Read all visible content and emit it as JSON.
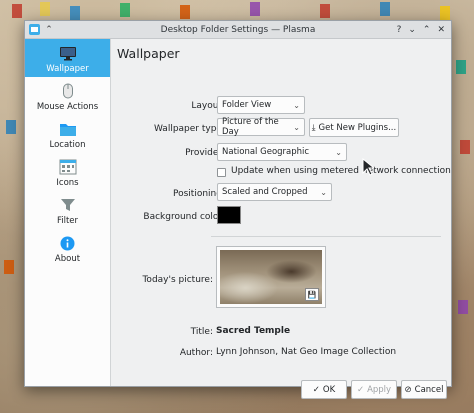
{
  "window": {
    "title": "Desktop Folder Settings — Plasma"
  },
  "sidebar": {
    "items": [
      {
        "label": "Wallpaper",
        "icon": "monitor-icon",
        "active": true
      },
      {
        "label": "Mouse Actions",
        "icon": "mouse-icon",
        "active": false
      },
      {
        "label": "Location",
        "icon": "folder-icon",
        "active": false
      },
      {
        "label": "Icons",
        "icon": "icons-grid-icon",
        "active": false
      },
      {
        "label": "Filter",
        "icon": "filter-icon",
        "active": false
      },
      {
        "label": "About",
        "icon": "info-icon",
        "active": false
      }
    ]
  },
  "main": {
    "heading": "Wallpaper",
    "layout": {
      "label": "Layout:",
      "value": "Folder View"
    },
    "wallpaper_type": {
      "label": "Wallpaper type:",
      "value": "Picture of the Day"
    },
    "get_plugins": {
      "label": "Get New Plugins..."
    },
    "provider": {
      "label": "Provider:",
      "value": "National Geographic"
    },
    "metered": {
      "label": "Update when using metered network connection",
      "checked": false
    },
    "positioning": {
      "label": "Positioning:",
      "value": "Scaled and Cropped"
    },
    "background_color": {
      "label": "Background color:",
      "value": "#000000"
    },
    "todays_picture": {
      "label": "Today's picture:"
    },
    "title": {
      "label": "Title:",
      "value": "Sacred Temple"
    },
    "author": {
      "label": "Author:",
      "value": "Lynn Johnson, Nat Geo Image Collection"
    }
  },
  "buttons": {
    "ok": "OK",
    "apply": "Apply",
    "cancel": "Cancel"
  },
  "colors": {
    "accent": "#3daee9",
    "window_bg": "#eff0f1"
  }
}
